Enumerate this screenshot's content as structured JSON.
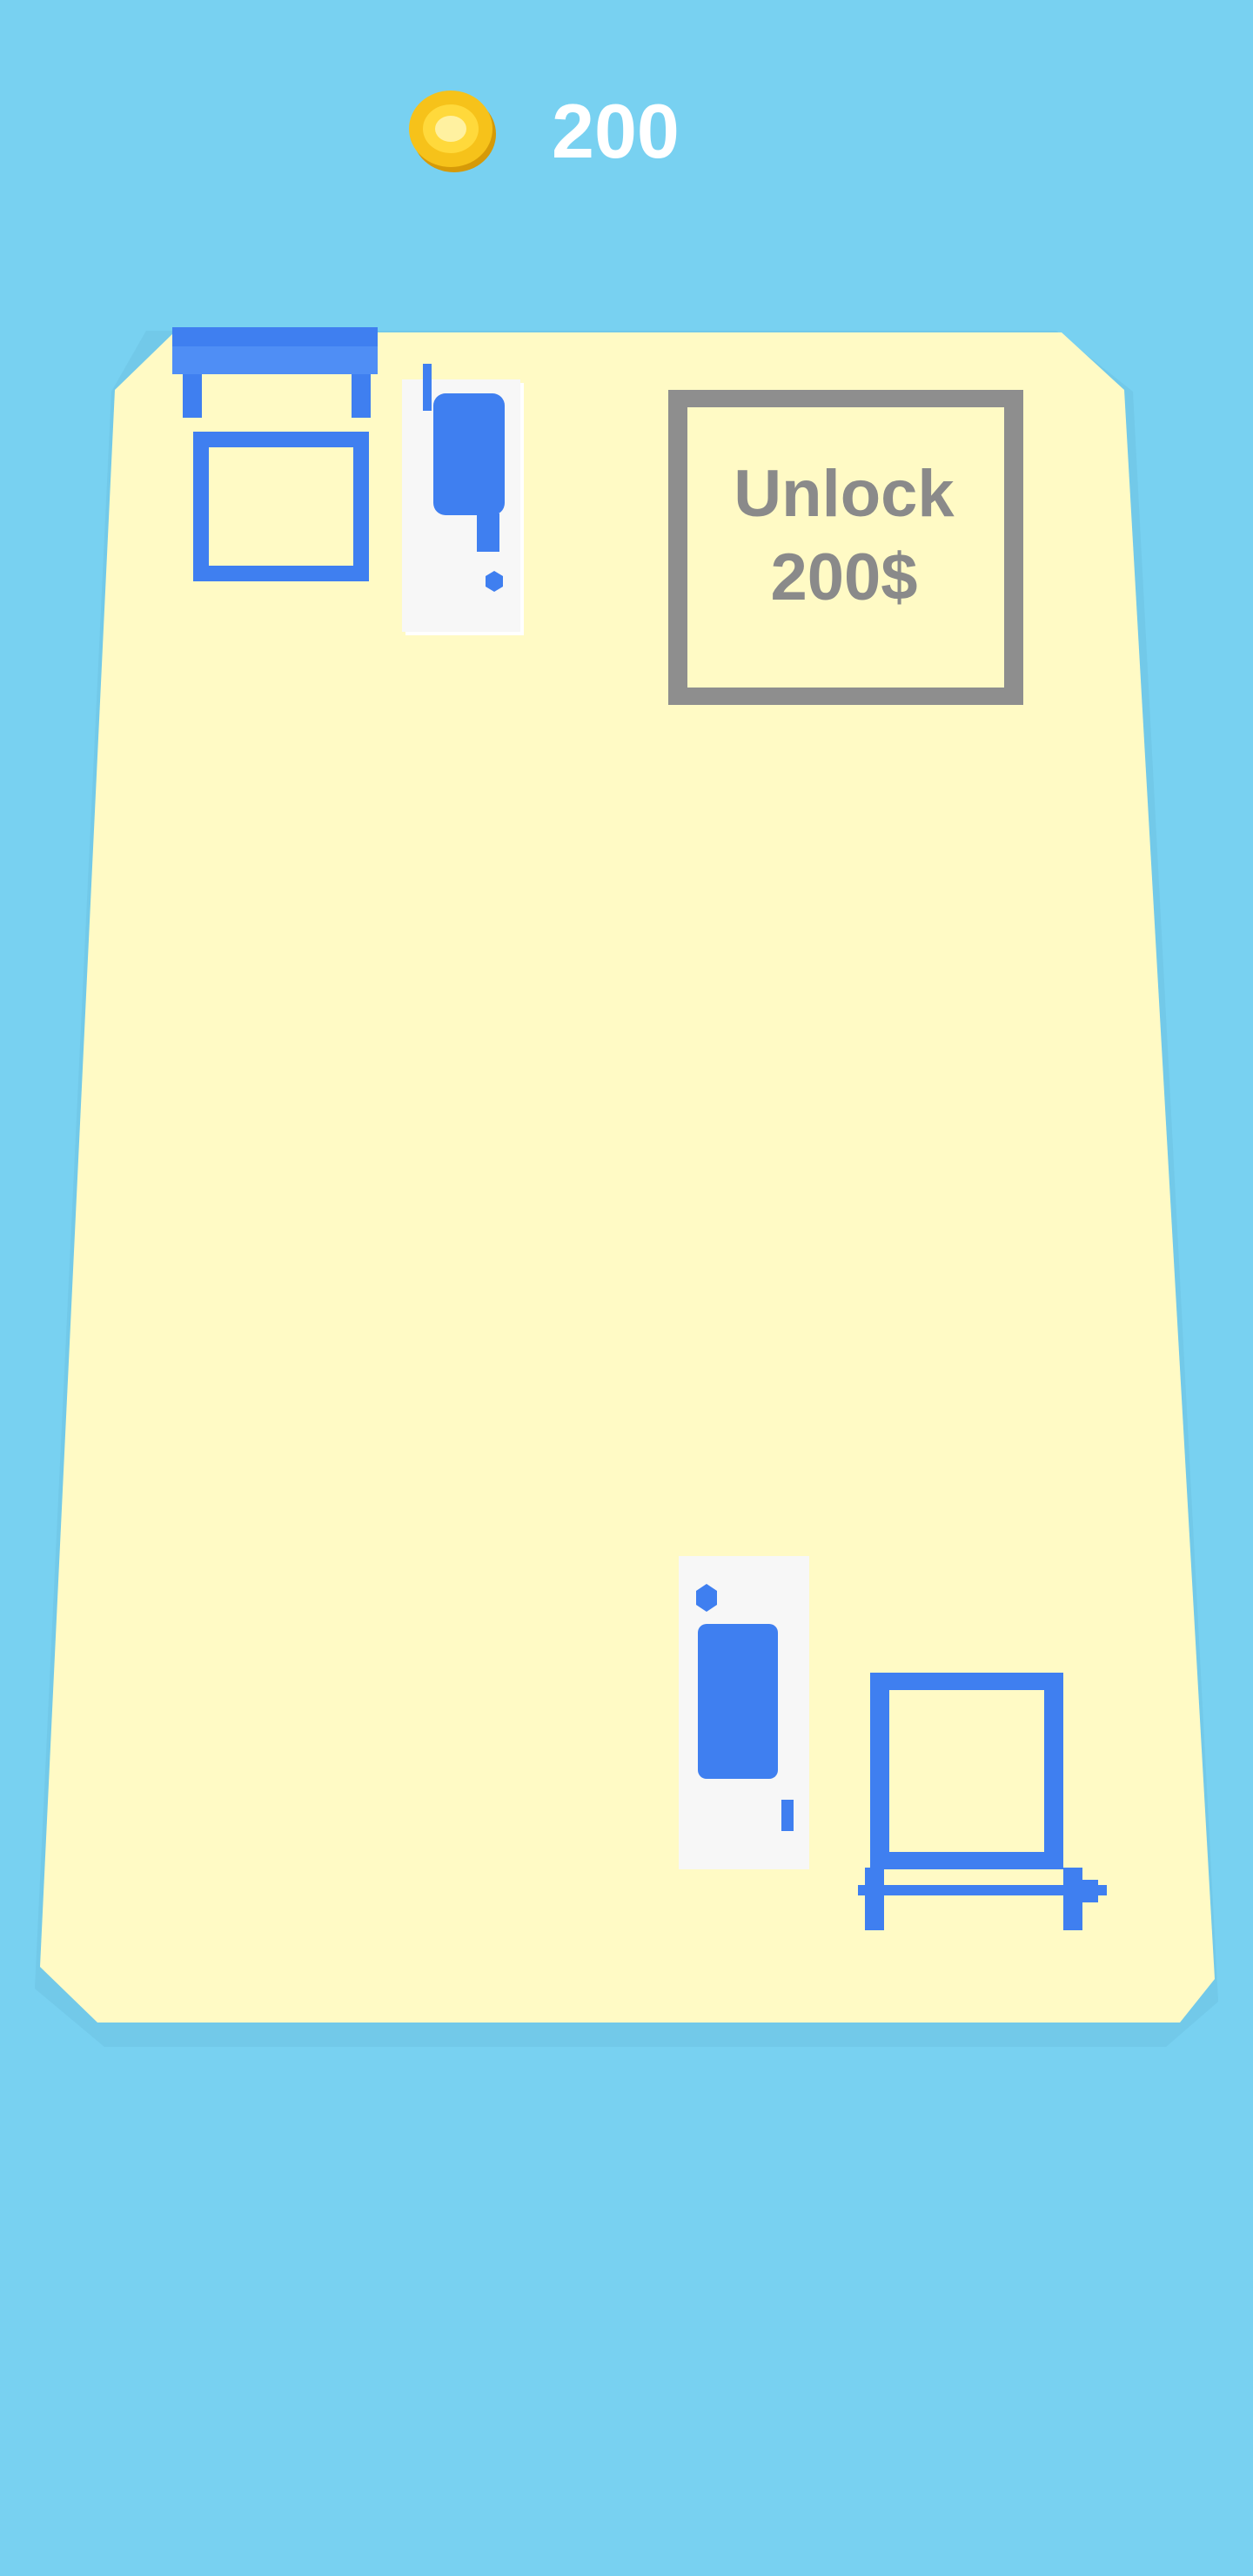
{
  "hud": {
    "coin_count": "200",
    "coin_icon": "gold-coin-icon"
  },
  "unlock_zone": {
    "line1": "Unlock",
    "line2": "200$"
  },
  "colors": {
    "sky": "#78d1f1",
    "floor": "#fffac5",
    "equipment": "#3f7ff0",
    "machine_base": "#ffffff",
    "unlock_frame": "#8e8e8e",
    "coin": "#f6c21a"
  }
}
